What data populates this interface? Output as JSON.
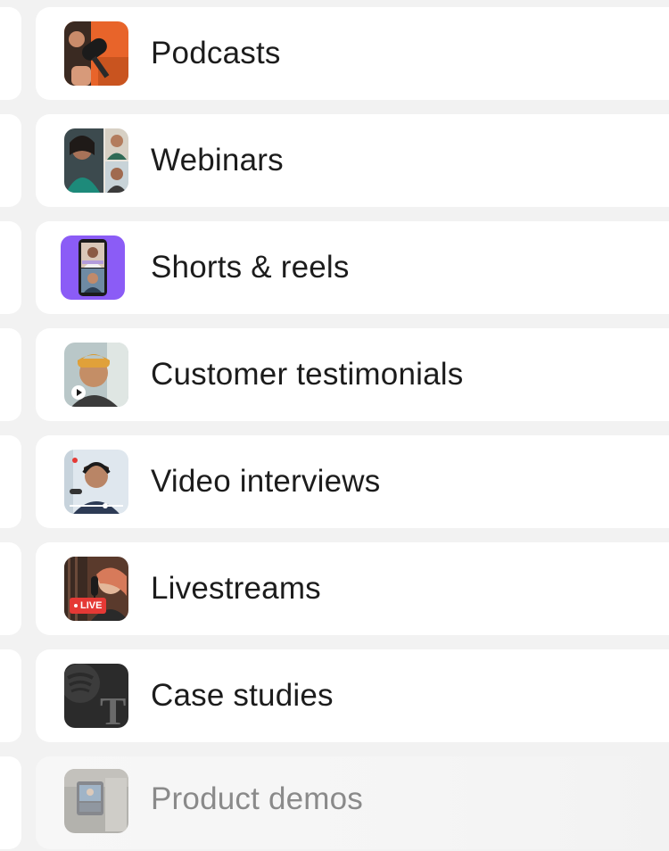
{
  "items": [
    {
      "label": "Podcasts",
      "icon": "podcast-microphone-icon"
    },
    {
      "label": "Webinars",
      "icon": "webinar-video-grid-icon"
    },
    {
      "label": "Shorts & reels",
      "icon": "vertical-video-phone-icon"
    },
    {
      "label": "Customer testimonials",
      "icon": "testimonial-video-play-icon"
    },
    {
      "label": "Video interviews",
      "icon": "interview-video-icon"
    },
    {
      "label": "Livestreams",
      "icon": "livestream-live-icon",
      "badge": "LIVE"
    },
    {
      "label": "Case studies",
      "icon": "case-study-logos-icon"
    },
    {
      "label": "Product demos",
      "icon": "product-demo-icon"
    }
  ],
  "colors": {
    "background": "#f2f2f2",
    "card": "#ffffff",
    "text": "#1c1c1c",
    "faded_text": "#8a8a8a",
    "live_badge": "#e53935",
    "shorts_purple": "#8b5cf6"
  }
}
